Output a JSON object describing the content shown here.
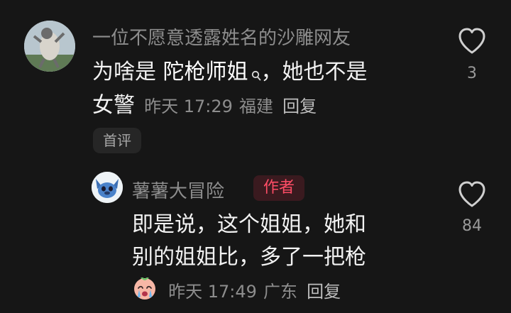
{
  "comment": {
    "username": "一位不愿意透露姓名的沙雕网友",
    "text_prefix": "为啥是 ",
    "linked_term": "陀枪师姐",
    "search_icon": "search-icon",
    "text_suffix": "，她也不是",
    "text_line2": "女警",
    "time": "昨天 17:29",
    "location": "福建",
    "reply_label": "回复",
    "first_badge": "首评",
    "like_count": "3"
  },
  "reply": {
    "username": "薯薯大冒险",
    "author_badge": "作者",
    "text_line1": "即是说，这个姐姐，她和",
    "text_line2": "别的姐姐比，多了一把枪",
    "emoji": "crying-face",
    "time": "昨天 17:49",
    "location": "广东",
    "reply_label": "回复",
    "like_count": "84"
  },
  "colors": {
    "background": "#161616",
    "author_badge": "#ff4d66"
  }
}
